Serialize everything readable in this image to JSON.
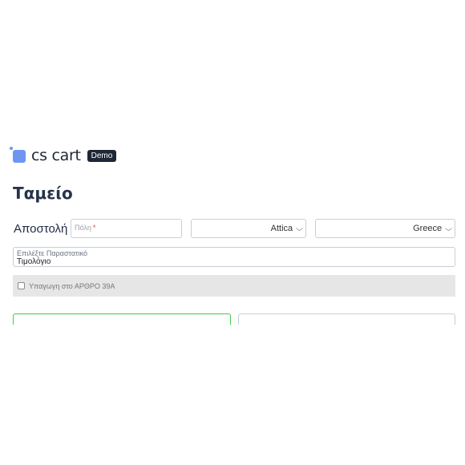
{
  "logo": {
    "text": "cs cart",
    "badge": "Demo"
  },
  "page": {
    "title": "Ταμείο"
  },
  "shipping": {
    "label": "Αποστολή",
    "city": {
      "placeholder": "Πόλη",
      "required_mark": "*"
    },
    "region": {
      "value": "Attica"
    },
    "country": {
      "value": "Greece"
    }
  },
  "document": {
    "label": "Επιλέξτε Παραστατικό",
    "value": "Τιμολόγιο"
  },
  "article": {
    "label": "Υπαγωγη στο ΑΡΘΡΟ 39Α",
    "checked": false
  },
  "colors": {
    "brand": "#6f95f2",
    "focus_border": "#3fcf3f",
    "article_bg": "#e6e6e6"
  },
  "icons": {
    "select_arrow": "chevron-down-icon",
    "logo": "cs-cart-logo-icon"
  }
}
